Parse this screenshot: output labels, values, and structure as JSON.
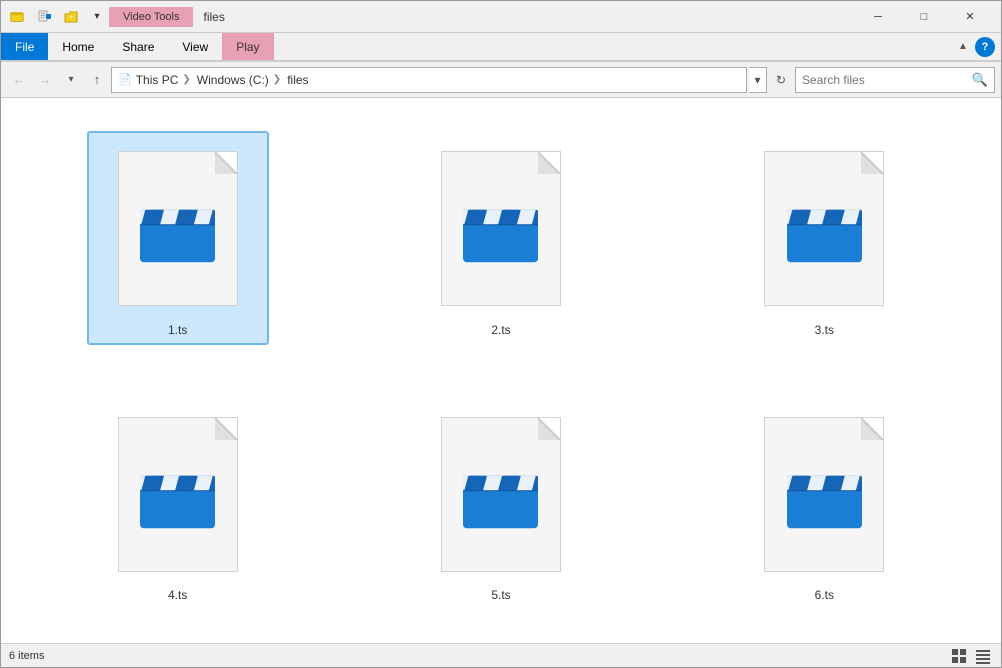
{
  "titleBar": {
    "videoToolsLabel": "Video Tools",
    "titleText": "files",
    "minimizeLabel": "─",
    "maximizeLabel": "□",
    "closeLabel": "✕"
  },
  "ribbon": {
    "tabs": [
      {
        "id": "file",
        "label": "File",
        "active": false
      },
      {
        "id": "home",
        "label": "Home",
        "active": false
      },
      {
        "id": "share",
        "label": "Share",
        "active": false
      },
      {
        "id": "view",
        "label": "View",
        "active": false
      },
      {
        "id": "play",
        "label": "Play",
        "active": true
      }
    ]
  },
  "addressBar": {
    "backTooltip": "Back",
    "forwardTooltip": "Forward",
    "upTooltip": "Up",
    "paths": [
      {
        "label": "This PC"
      },
      {
        "label": "Windows (C:)"
      },
      {
        "label": "files"
      }
    ],
    "searchPlaceholder": "Search files"
  },
  "files": [
    {
      "id": 1,
      "name": "1.ts",
      "selected": true
    },
    {
      "id": 2,
      "name": "2.ts",
      "selected": false
    },
    {
      "id": 3,
      "name": "3.ts",
      "selected": false
    },
    {
      "id": 4,
      "name": "4.ts",
      "selected": false
    },
    {
      "id": 5,
      "name": "5.ts",
      "selected": false
    },
    {
      "id": 6,
      "name": "6.ts",
      "selected": false
    }
  ],
  "statusBar": {
    "itemCount": "6 items"
  },
  "colors": {
    "accent": "#0078d7",
    "clapperBlue": "#1a7fd4",
    "clapperDarkBlue": "#1565b8"
  }
}
